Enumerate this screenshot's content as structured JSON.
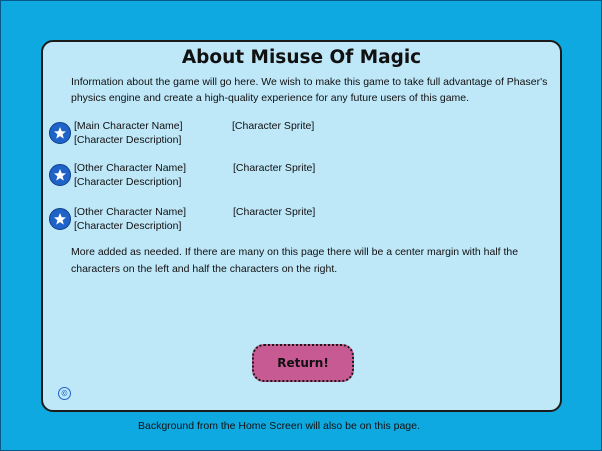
{
  "page": {
    "title": "About Misuse Of Magic",
    "intro": "Information about the game will go here. We wish to make this game to take full advantage of Phaser's physics engine and create a high-quality experience for any future users of this game.",
    "characters": [
      {
        "name": "[Main Character Name]",
        "description": "[Character Description]",
        "sprite": "[Character Sprite]",
        "icon": "star-icon"
      },
      {
        "name": "[Other Character Name]",
        "description": "[Character Description]",
        "sprite": "[Character Sprite]",
        "icon": "star-icon"
      },
      {
        "name": "[Other Character Name]",
        "description": "[Character Description]",
        "sprite": "[Character Sprite]",
        "icon": "star-icon"
      }
    ],
    "more_text": "More added as needed. If there are many on this page there will be a center margin with half the characters on the left and half the characters on the right.",
    "return_label": "Return!",
    "copyright_symbol": "©"
  },
  "footer_note": "Background from the Home Screen will also be on this page.",
  "colors": {
    "background": "#0ea9e0",
    "panel": "#bee7f8",
    "button": "#c75a93",
    "badge": "#1f63c9"
  }
}
